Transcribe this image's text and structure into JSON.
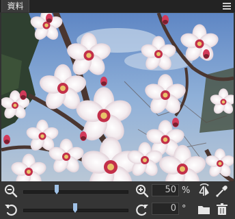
{
  "panel": {
    "tab_label": "資料",
    "menu_icon": "hamburger-menu-icon"
  },
  "preview": {
    "description_icon": "image-preview"
  },
  "zoom": {
    "value": "50",
    "unit": "%",
    "slider_level": 0.32
  },
  "rotation": {
    "value": "0",
    "unit": "°",
    "slider_level": 0.5
  },
  "colors": {
    "background": "#323232",
    "titlebar": "#232323",
    "field": "#262626"
  }
}
